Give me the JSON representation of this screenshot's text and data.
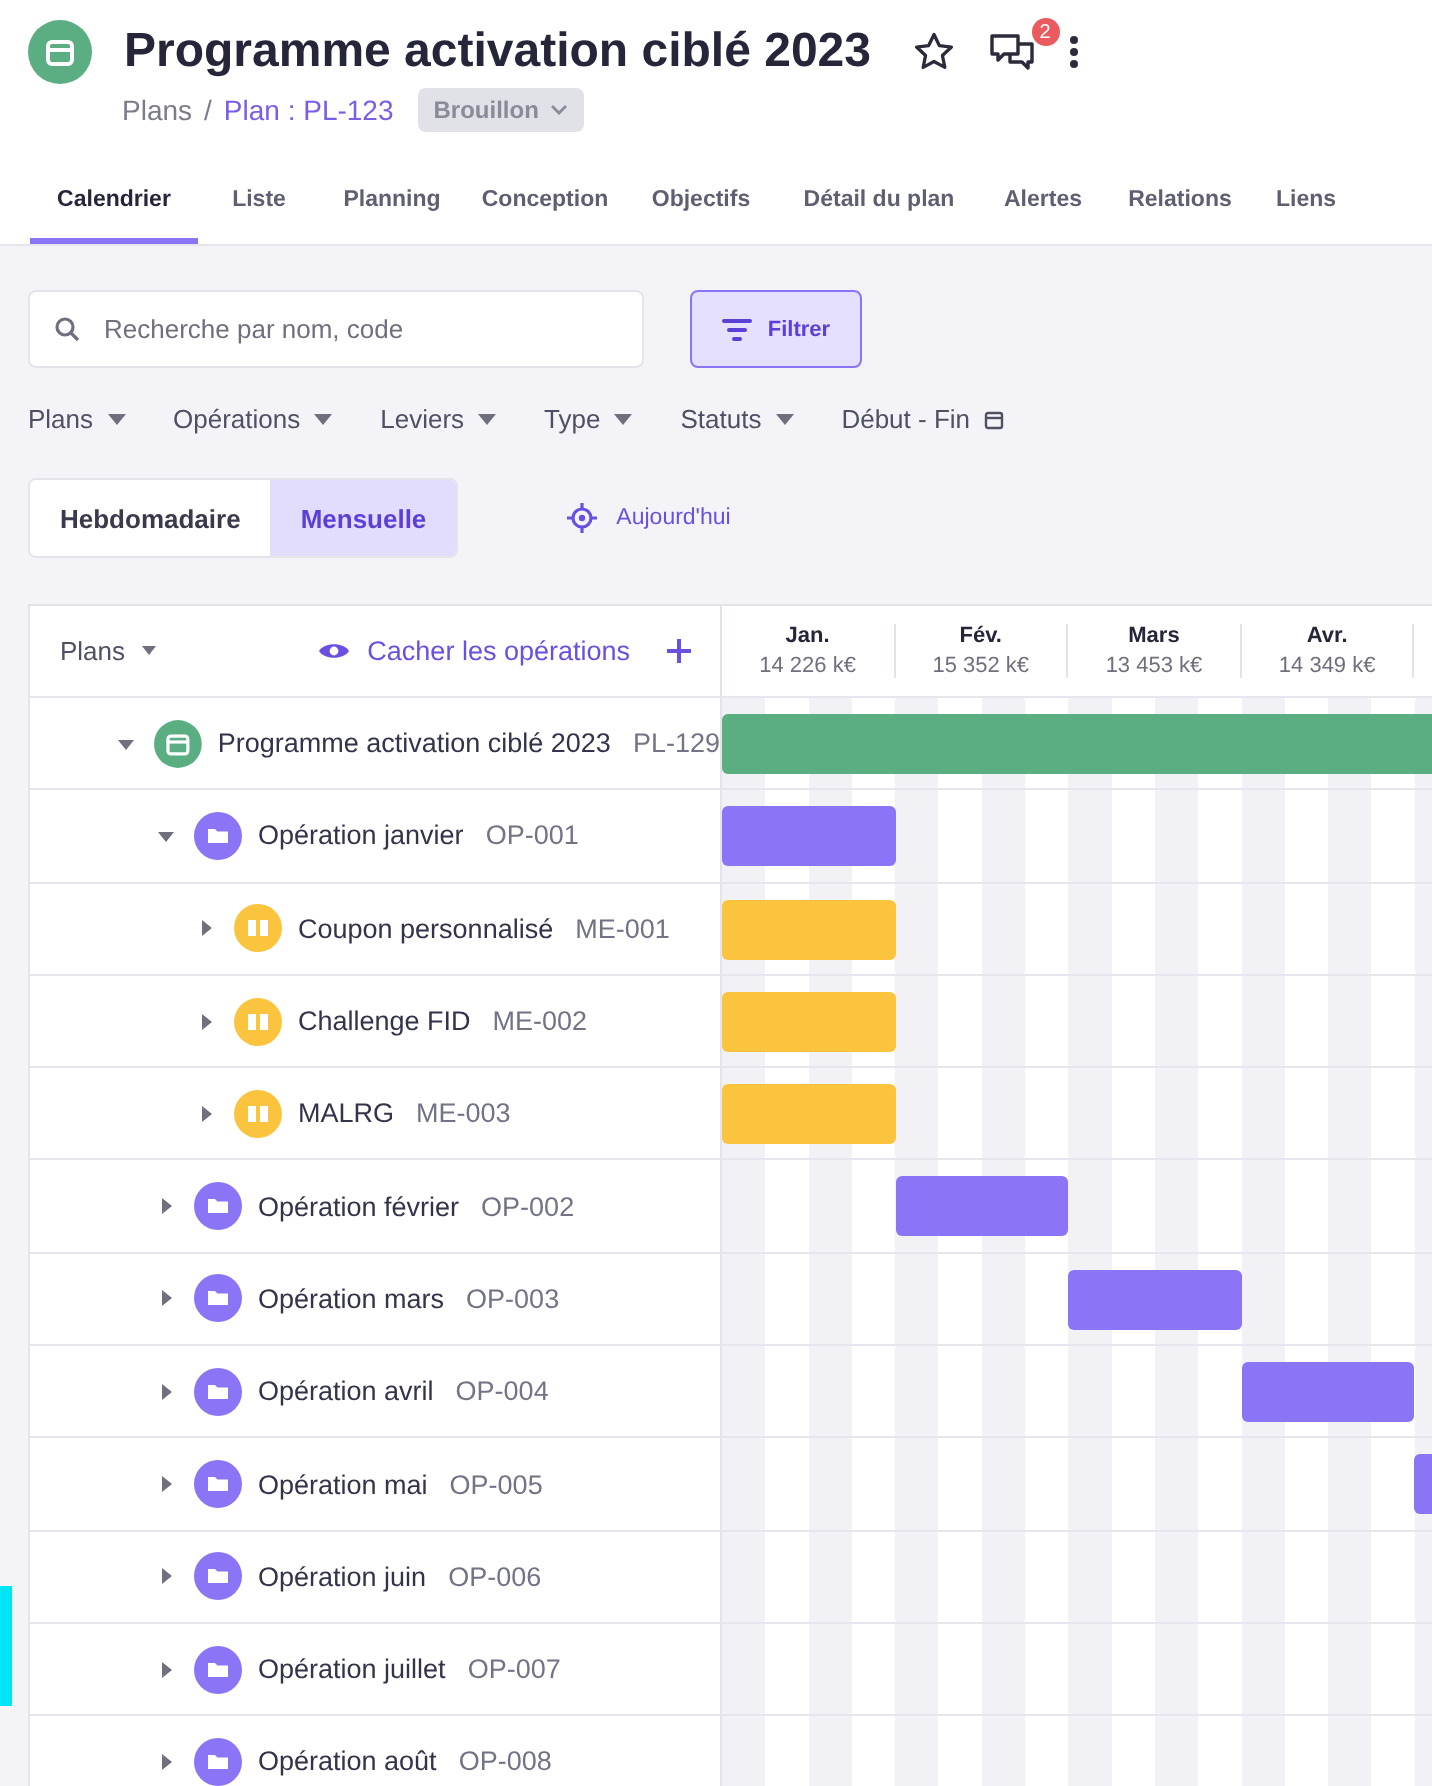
{
  "header": {
    "title": "Programme activation ciblé 2023",
    "notification_count": "2",
    "breadcrumb": [
      {
        "label": "Plans",
        "kind": "plain"
      },
      {
        "label": "Plan : PL-123",
        "kind": "link"
      }
    ],
    "breadcrumb_separator": "/",
    "status": "Brouillon"
  },
  "tabs": [
    {
      "label": "Calendrier",
      "selected": true
    },
    {
      "label": "Liste",
      "selected": false
    },
    {
      "label": "Planning",
      "selected": false
    },
    {
      "label": "Conception",
      "selected": false
    },
    {
      "label": "Objectifs",
      "selected": false
    },
    {
      "label": "Détail du plan",
      "selected": false
    },
    {
      "label": "Alertes",
      "selected": false
    },
    {
      "label": "Relations",
      "selected": false
    },
    {
      "label": "Liens",
      "selected": false
    }
  ],
  "search": {
    "placeholder": "Recherche par nom, code"
  },
  "filter_button": "Filtrer",
  "filters": [
    {
      "label": "Plans",
      "kind": "dropdown"
    },
    {
      "label": "Opérations",
      "kind": "dropdown"
    },
    {
      "label": "Leviers",
      "kind": "dropdown"
    },
    {
      "label": "Type",
      "kind": "dropdown"
    },
    {
      "label": "Statuts",
      "kind": "dropdown"
    },
    {
      "label": "Début - Fin",
      "kind": "date"
    }
  ],
  "view_modes": [
    {
      "label": "Hebdomadaire",
      "selected": false
    },
    {
      "label": "Mensuelle",
      "selected": true
    }
  ],
  "today_button": "Aujourd'hui",
  "table": {
    "column_header": "Plans",
    "hide_link": "Cacher les opérations",
    "months": [
      {
        "label": "Jan.",
        "amount": "14 226 k€"
      },
      {
        "label": "Fév.",
        "amount": "15 352 k€"
      },
      {
        "label": "Mars",
        "amount": "13 453 k€"
      },
      {
        "label": "Avr.",
        "amount": "14 349 k€"
      }
    ],
    "rows": [
      {
        "kind": "plan",
        "name": "Programme activation ciblé 2023",
        "code": "PL-129",
        "expanded": true,
        "children": [
          {
            "kind": "operation",
            "name": "Opération janvier",
            "code": "OP-001",
            "expanded": true,
            "children": [
              {
                "kind": "lever",
                "name": "Coupon personnalisé",
                "code": "ME-001",
                "expanded": false
              },
              {
                "kind": "lever",
                "name": "Challenge FID",
                "code": "ME-002",
                "expanded": false
              },
              {
                "kind": "lever",
                "name": "MALRG",
                "code": "ME-003",
                "expanded": false
              }
            ]
          },
          {
            "kind": "operation",
            "name": "Opération février",
            "code": "OP-002",
            "expanded": false
          },
          {
            "kind": "operation",
            "name": "Opération mars",
            "code": "OP-003",
            "expanded": false
          },
          {
            "kind": "operation",
            "name": "Opération avril",
            "code": "OP-004",
            "expanded": false
          },
          {
            "kind": "operation",
            "name": "Opération mai",
            "code": "OP-005",
            "expanded": false
          },
          {
            "kind": "operation",
            "name": "Opération juin",
            "code": "OP-006",
            "expanded": false
          },
          {
            "kind": "operation",
            "name": "Opération juillet",
            "code": "OP-007",
            "expanded": false
          },
          {
            "kind": "operation",
            "name": "Opération août",
            "code": "OP-008",
            "expanded": false
          }
        ]
      }
    ]
  }
}
